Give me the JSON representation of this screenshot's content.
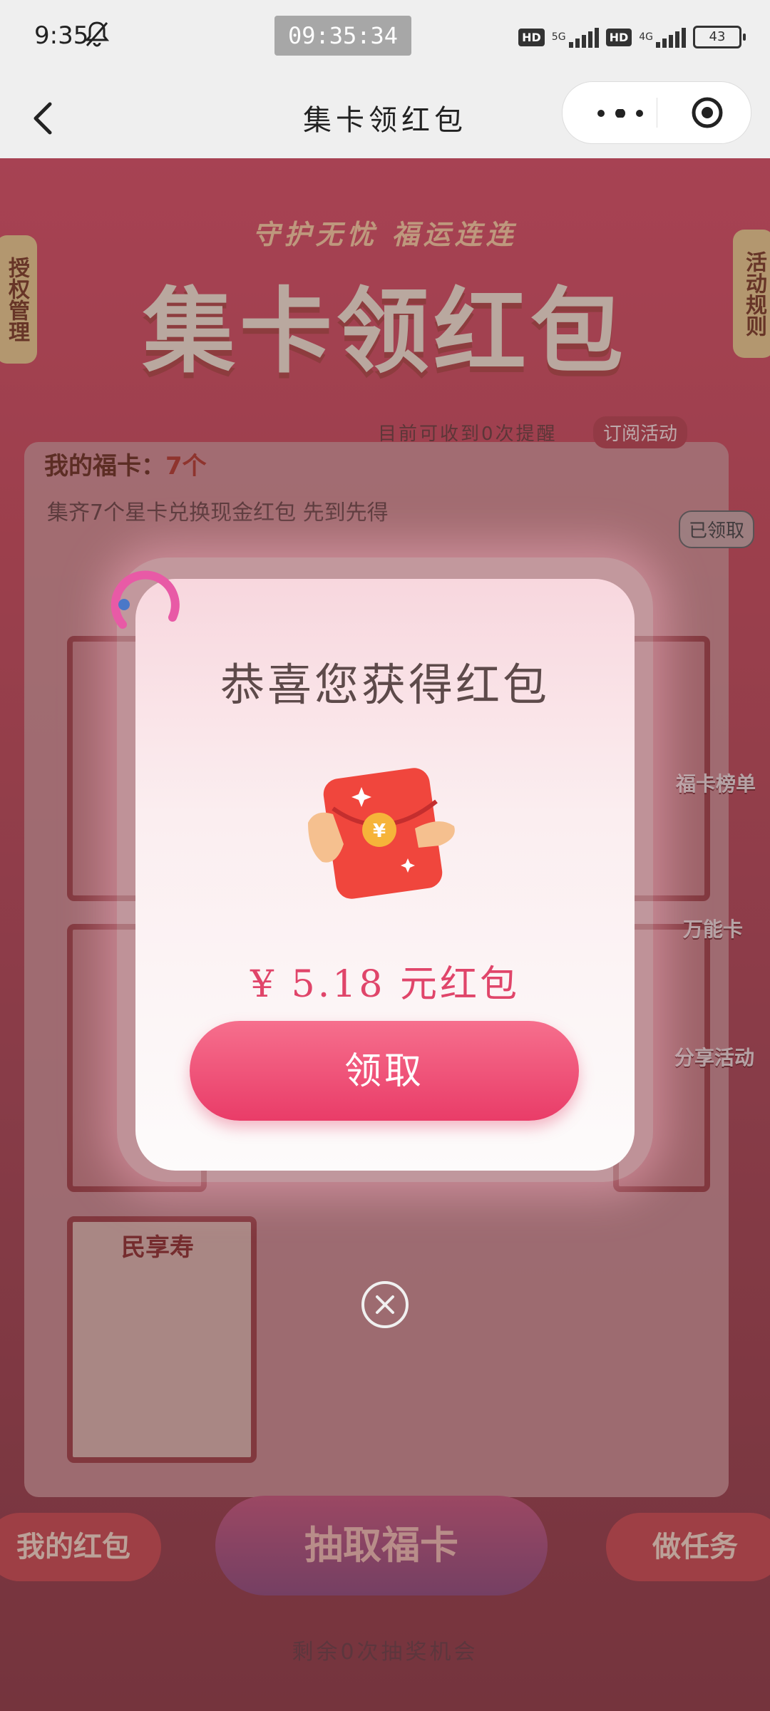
{
  "status_bar": {
    "time": "9:35",
    "clock": "09:35:34",
    "hd1": "HD",
    "net1": "5G",
    "hd2": "HD",
    "net2": "4G",
    "battery": "43"
  },
  "nav": {
    "title": "集卡领红包"
  },
  "page": {
    "side_left": "授权管理",
    "side_right": "活动规则",
    "slogan": "守护无忧  福运连连",
    "big_title": "集卡领红包",
    "remind_text": "目前可收到0次提醒",
    "subscribe_label": "订阅活动",
    "my_cards_label": "我的福卡：",
    "my_cards_count": "7个",
    "collect_tip": "集齐7个星卡兑换现金红包 先到先得",
    "claimed_badge": "已领取",
    "card_label_minxiang": "民享寿",
    "right_items": [
      "福卡榜单",
      "万能卡",
      "分享活动"
    ],
    "bottom_left": "我的红包",
    "bottom_mid": "抽取福卡",
    "bottom_right": "做任务",
    "chances": "剩余0次抽奖机会"
  },
  "modal": {
    "title": "恭喜您获得红包",
    "amount": "¥ 5.18 元红包",
    "claim_label": "领取"
  },
  "colors": {
    "accent_pink": "#e93c68",
    "amount_color": "#e0456a"
  }
}
